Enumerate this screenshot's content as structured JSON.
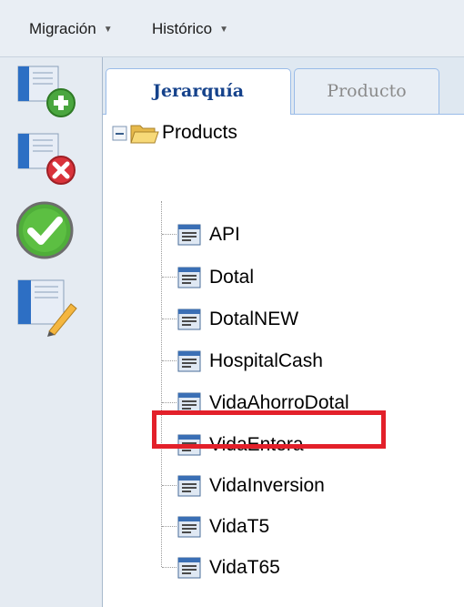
{
  "menubar": {
    "items": [
      {
        "label": "Migración",
        "arrow": "▼"
      },
      {
        "label": "Histórico",
        "arrow": "▼"
      }
    ]
  },
  "toolbar": {
    "buttons": [
      {
        "icon": "add-document-icon"
      },
      {
        "icon": "delete-document-icon"
      },
      {
        "icon": "checkmark-icon"
      },
      {
        "icon": "edit-document-icon"
      }
    ]
  },
  "tabs": [
    {
      "label": "Jerarquía",
      "active": true
    },
    {
      "label": "Producto",
      "active": false
    }
  ],
  "tree": {
    "root": {
      "label": "Products",
      "expanded": true
    },
    "children": [
      {
        "label": "API"
      },
      {
        "label": "Dotal"
      },
      {
        "label": "DotalNEW"
      },
      {
        "label": "HospitalCash"
      },
      {
        "label": "VidaAhorroDotal"
      },
      {
        "label": "VidaEntera"
      },
      {
        "label": "VidaInversion",
        "highlighted": true
      },
      {
        "label": "VidaT5"
      },
      {
        "label": "VidaT65"
      }
    ]
  },
  "colors": {
    "highlight": "#e3202a",
    "active_tab_text": "#15428b",
    "toolbar_bg": "#e5ebf2"
  }
}
